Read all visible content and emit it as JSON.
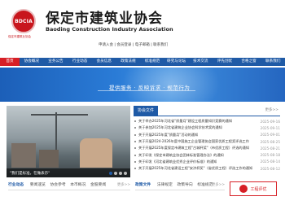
{
  "header": {
    "logo_text": "BDCIA",
    "logo_sub": "保定市建筑业协会",
    "title": "保定市建筑业协会",
    "subtitle": "Baoding Construction Industry Association",
    "top_links": [
      "申请入会",
      "会员登录",
      "电子邮箱",
      "联系我们"
    ]
  },
  "nav": {
    "items": [
      "首页",
      "协会概况",
      "业务公告",
      "行业动态",
      "会员信息",
      "政策法规",
      "标准规范",
      "研究与论坛",
      "技术交流",
      "评先创优",
      "合格之窗",
      "联系我们"
    ]
  },
  "banner": {
    "text": "提供服务 · 反映诉求 · 规范行为"
  },
  "photo": {
    "caption": "\"我们是标准，在做表示\""
  },
  "news": {
    "tab": "协会文件",
    "more": "更多>>",
    "items": [
      {
        "title": "关于举办2025年河北省\"质量月\"建设工程质量知识竞赛的通知",
        "date": "2025-09-16"
      },
      {
        "title": "关于参加2025年河北省建筑企业协会科学技术奖的通知",
        "date": "2025-09-11"
      },
      {
        "title": "关于开展2025年度\"质量月\"活动的通知",
        "date": "2025-09-01"
      },
      {
        "title": "关于开展2024-2026年度中国施工企业管理协会国家优质工程奖评选工作",
        "date": "2025-08-25"
      },
      {
        "title": "关于开展2025年度保定市建筑工程\"古城杯奖\"（市优质工程）评选的通知",
        "date": "2025-08-21"
      },
      {
        "title": "关于印发《保定市建筑业协会团体标准管理办法》的通知",
        "date": "2025-08-18"
      },
      {
        "title": "关于印发《河北省建筑业优秀企业评价标准》的通知",
        "date": "2025-08-14"
      },
      {
        "title": "关于开展2025年河北省建设工程\"安济杯奖\"（省优质工程）评选工作的通知",
        "date": "2025-08-12"
      }
    ]
  },
  "bottom": {
    "left": {
      "title": "行业动态",
      "links": [
        "要闻速览",
        "协会参考",
        "本市概况",
        "金股要闻"
      ],
      "more": "更多>>"
    },
    "right": {
      "title": "政策文件",
      "links": [
        "法律规定",
        "政策导向",
        "标准规范"
      ],
      "more": "更多>>"
    },
    "badge": "工程评优"
  }
}
